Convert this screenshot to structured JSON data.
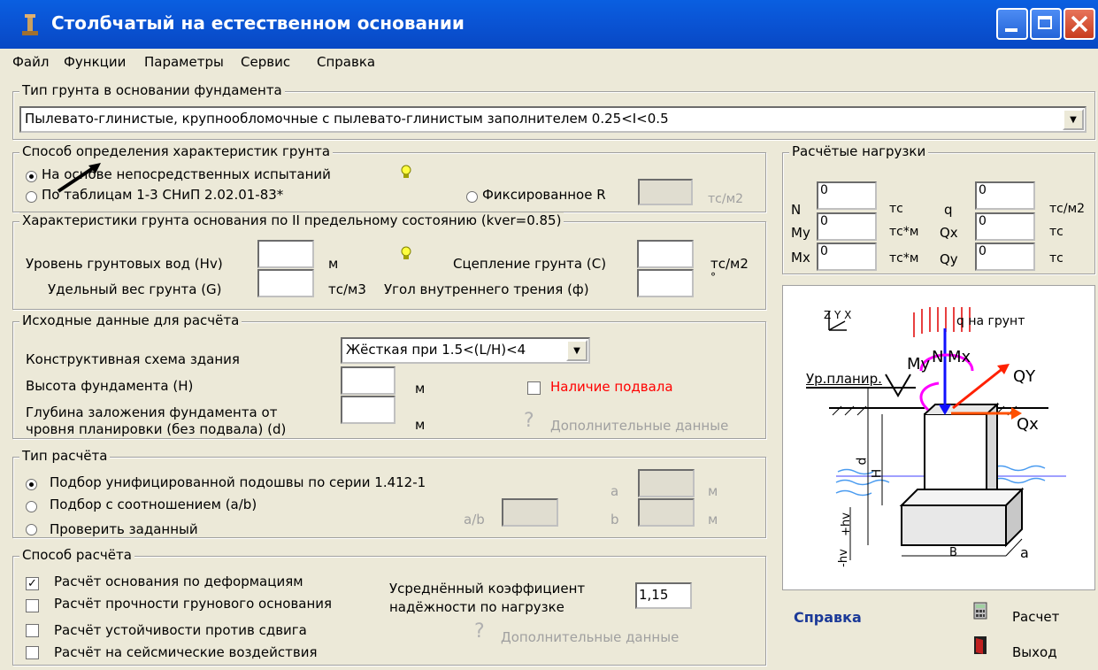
{
  "window": {
    "title": "Столбчатый на естественном основании",
    "minimize_icon": "minimize-icon",
    "maximize_icon": "maximize-icon",
    "close_icon": "close-icon",
    "colors": {
      "titlebar": "#0a55d6",
      "bg": "#ece9d8",
      "red_label": "#ff0000",
      "link": "#1c3a98"
    }
  },
  "menu": [
    "Файл",
    "Функции",
    "Параметры",
    "Сервис",
    "Справка"
  ],
  "soil_type": {
    "title": "Тип грунта в основании фундамента",
    "value": "Пылевато-глинистые, крупнообломочные с пылевато-глинистым заполнителем  0.25<I<0.5"
  },
  "method": {
    "title": "Способ определения характеристик грунта",
    "opt1": "На основе непосредственных испытаний",
    "opt2": "По таблицам 1-3 СНиП 2.02.01-83*",
    "opt3": "Фиксированное R",
    "unit": "тс/м2",
    "r_value": ""
  },
  "soil_chars": {
    "title": "Характеристики грунта основания по II предельному состоянию (kver=0.85)",
    "gw_label": "Уровень грунтовых вод (Hv)",
    "gw_value": "",
    "gw_unit": "м",
    "weight_label": "Удельный вес грунта (G)",
    "weight_value": "",
    "weight_unit": "тс/м3",
    "cohesion_label": "Сцепление грунта (C)",
    "cohesion_value": "",
    "cohesion_unit": "тс/м2",
    "angle_label": "Угол внутреннего трения (ф)",
    "angle_value": "",
    "angle_unit": "°"
  },
  "input_data": {
    "title": "Исходные данные для расчёта",
    "scheme_label": "Конструктивная схема здания",
    "scheme_value": "Жёсткая при 1.5<(L/H)<4",
    "height_label": "Высота фундамента (H)",
    "height_value": "",
    "height_unit": "м",
    "depth_label1": "Глубина заложения фундамента от",
    "depth_label2": "чровня планировки (без подвала) (d)",
    "depth_value": "",
    "depth_unit": "м",
    "basement_label": "Наличие подвала",
    "extra_label": "Дополнительные данные"
  },
  "calc_type": {
    "title": "Тип расчёта",
    "opt1": "Подбор унифицированной подошвы по серии 1.412-1",
    "opt2": "Подбор с соотношением (a/b)",
    "opt3": "Проверить заданный",
    "ab_label": "a/b",
    "a_label": "a",
    "b_label": "b",
    "unit": "м"
  },
  "calc_method": {
    "title": "Способ расчёта",
    "chk1": "Расчёт основания по деформациям",
    "chk2": "Расчёт прочности грунового основания",
    "chk3": "Расчёт устойчивости против сдвига",
    "chk4": "Расчёт на сейсмические воздействия",
    "coef_label1": "Усреднённый коэффициент",
    "coef_label2": "надёжности по нагрузке",
    "coef_value": "1,15",
    "extra_label": "Дополнительные данные"
  },
  "loads": {
    "title": "Расчётые нагрузки",
    "N_label": "N",
    "N_value": "0",
    "N_unit": "тс",
    "My_label": "My",
    "My_value": "0",
    "My_unit": "тс*м",
    "Mx_label": "Mx",
    "Mx_value": "0",
    "Mx_unit": "тс*м",
    "q_label": "q",
    "q_value": "0",
    "q_unit": "тс/м2",
    "Qx_label": "Qx",
    "Qx_value": "0",
    "Qx_unit": "тс",
    "Qy_label": "Qy",
    "Qy_value": "0",
    "Qy_unit": "тс"
  },
  "diagram": {
    "axes": "Z Y X",
    "q_label": "q на грунт",
    "plan_label": "Ур.планир.",
    "My": "My",
    "N": "N",
    "Mx": "Mx",
    "Qy": "QY",
    "Qx": "Qx",
    "d": "d",
    "H": "H",
    "hv": "+hv",
    "minus_hv": "-hv",
    "B": "B",
    "a": "a"
  },
  "footer": {
    "help": "Справка",
    "calc": "Расчет",
    "exit": "Выход"
  }
}
